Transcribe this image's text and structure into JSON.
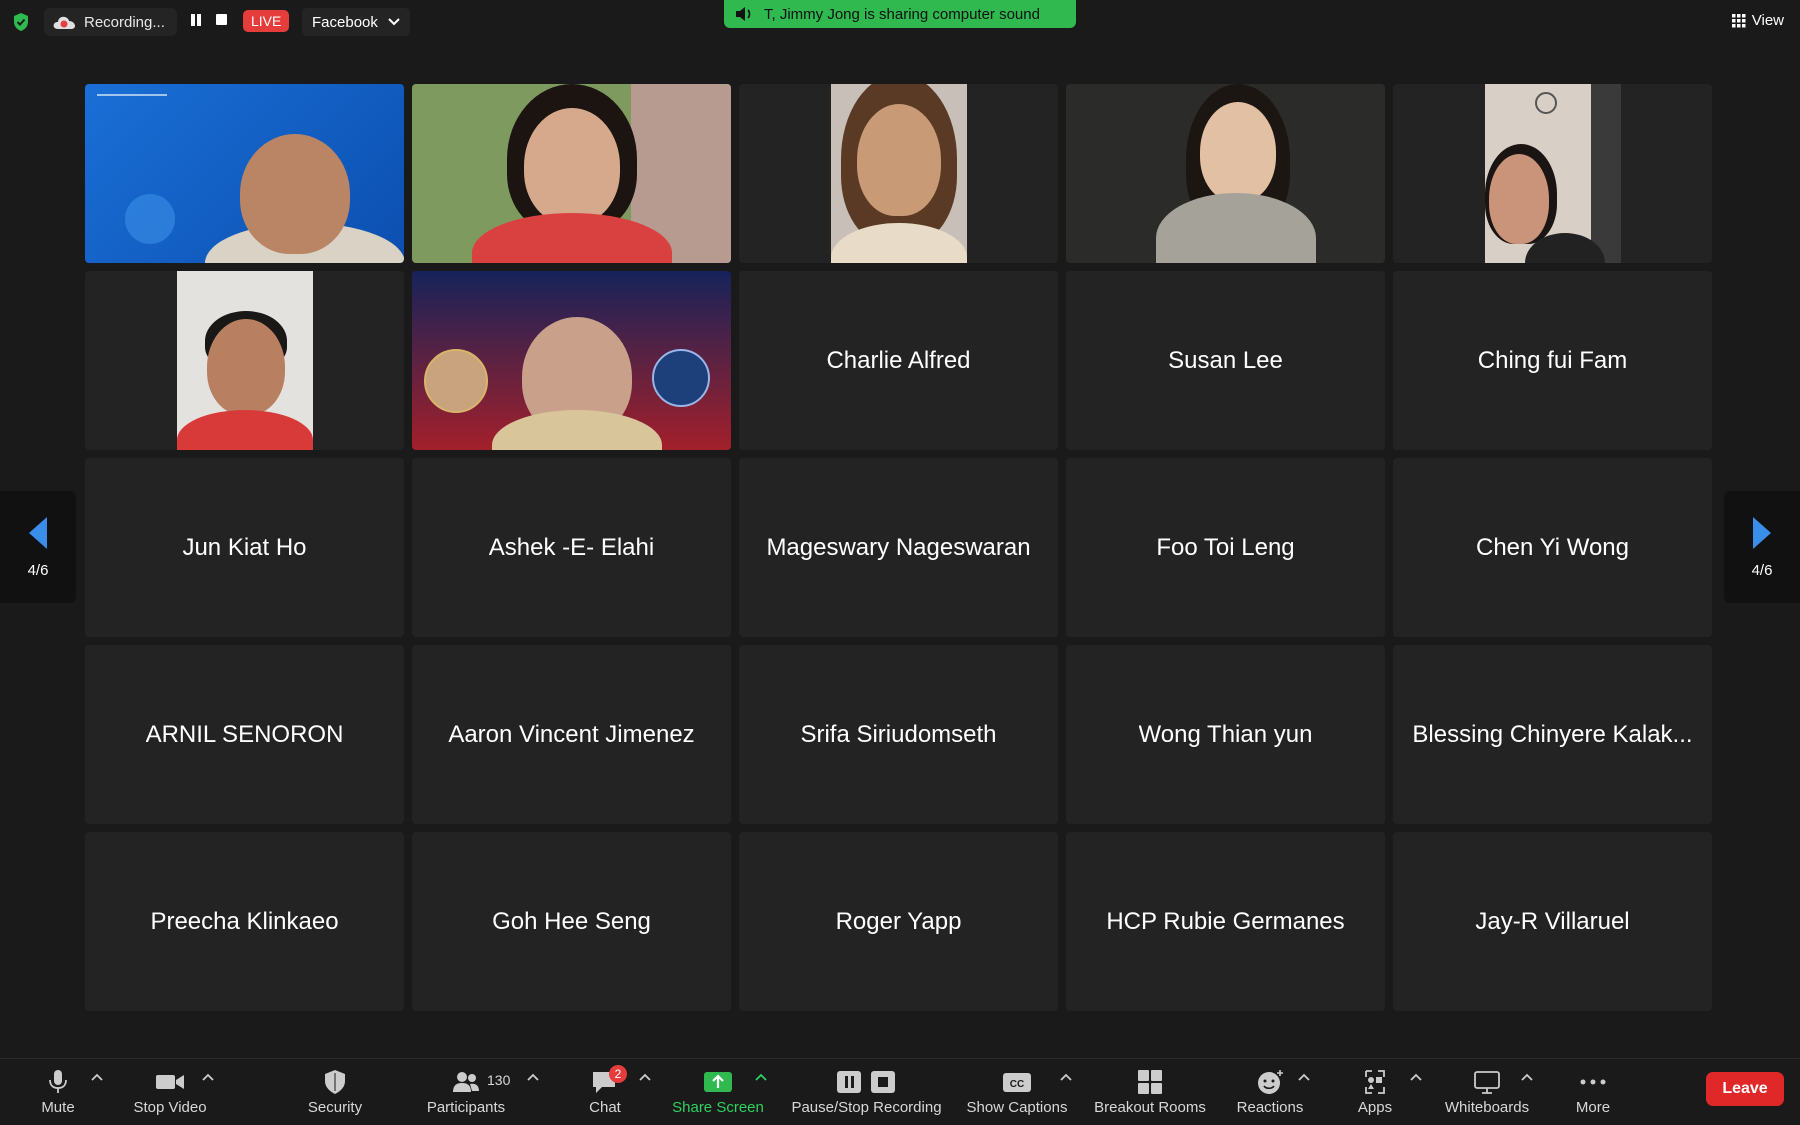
{
  "topbar": {
    "recording_label": "Recording...",
    "live_label": "LIVE",
    "stream_target": "Facebook",
    "sharing_notice": "T, Jimmy Jong is sharing computer sound",
    "view_label": "View"
  },
  "pager": {
    "left_page": "4/6",
    "right_page": "4/6"
  },
  "video_tiles": [
    {
      "id": "v1",
      "kind": "video"
    },
    {
      "id": "v2",
      "kind": "video"
    },
    {
      "id": "v3",
      "kind": "video"
    },
    {
      "id": "v4",
      "kind": "video"
    },
    {
      "id": "v5",
      "kind": "video"
    },
    {
      "id": "v6",
      "kind": "video"
    },
    {
      "id": "v7",
      "kind": "video"
    }
  ],
  "participants": [
    "Charlie Alfred",
    "Susan Lee",
    "Ching fui Fam",
    "Jun Kiat Ho",
    "Ashek -E- Elahi",
    "Mageswary Nageswaran",
    "Foo Toi Leng",
    "Chen Yi Wong",
    "ARNIL SENORON",
    "Aaron Vincent Jimenez",
    "Srifa Siriudomseth",
    "Wong Thian yun",
    "Blessing Chinyere Kalak...",
    "Preecha Klinkaeo",
    "Goh Hee Seng",
    "Roger Yapp",
    "HCP Rubie Germanes",
    "Jay-R Villaruel"
  ],
  "toolbar": {
    "mute": "Mute",
    "stop_video": "Stop Video",
    "security": "Security",
    "participants": "Participants",
    "participants_count": "130",
    "chat": "Chat",
    "chat_badge": "2",
    "share_screen": "Share Screen",
    "pause_stop_recording": "Pause/Stop Recording",
    "show_captions": "Show Captions",
    "breakout_rooms": "Breakout Rooms",
    "reactions": "Reactions",
    "apps": "Apps",
    "whiteboards": "Whiteboards",
    "more": "More",
    "leave": "Leave"
  },
  "colors": {
    "live_red": "#e53c3c",
    "share_green": "#2fb94f",
    "leave_red": "#e02828",
    "tile_bg": "#232323",
    "pager_arrow": "#3b8dea"
  }
}
